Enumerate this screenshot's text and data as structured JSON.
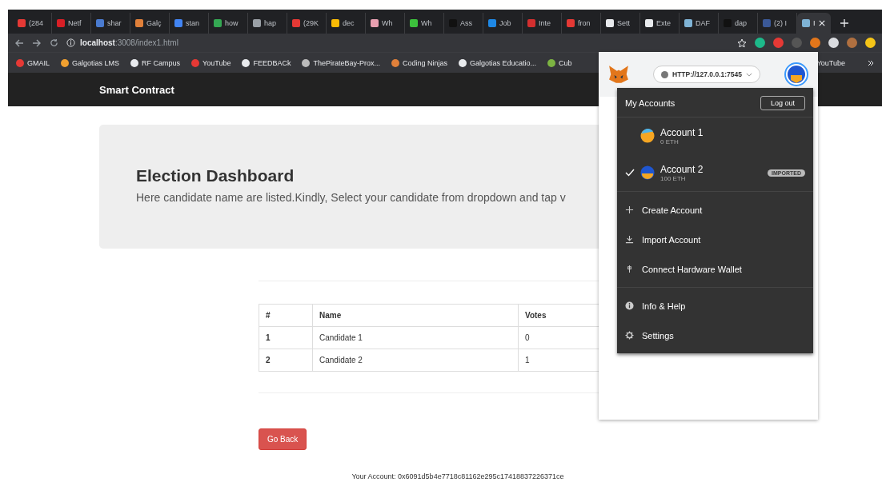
{
  "browser": {
    "tabs": [
      {
        "label": "(284",
        "color": "#e53935",
        "selected": false
      },
      {
        "label": "Netf",
        "color": "#d81f26",
        "selected": false
      },
      {
        "label": "shar",
        "color": "#4a7bd0",
        "selected": false
      },
      {
        "label": "Galç",
        "color": "#e0803a",
        "selected": false
      },
      {
        "label": "stan",
        "color": "#4285f4",
        "selected": false
      },
      {
        "label": "how",
        "color": "#34a853",
        "selected": false
      },
      {
        "label": "hap",
        "color": "#9aa0a6",
        "selected": false
      },
      {
        "label": "(29K",
        "color": "#e53935",
        "selected": false
      },
      {
        "label": "dec",
        "color": "#fbbc05",
        "selected": false
      },
      {
        "label": "Wh",
        "color": "#e8a0b0",
        "selected": false
      },
      {
        "label": "Wh",
        "color": "#3cc13c",
        "selected": false
      },
      {
        "label": "Ass",
        "color": "#111111",
        "selected": false
      },
      {
        "label": "Job",
        "color": "#1e88e5",
        "selected": false
      },
      {
        "label": "Inte",
        "color": "#d32f2f",
        "selected": false
      },
      {
        "label": "fron",
        "color": "#e53935",
        "selected": false
      },
      {
        "label": "Sett",
        "color": "#e8eaed",
        "selected": false
      },
      {
        "label": "Exte",
        "color": "#e8eaed",
        "selected": false
      },
      {
        "label": "DAF",
        "color": "#7fb3d5",
        "selected": false
      },
      {
        "label": "dap",
        "color": "#111111",
        "selected": false
      },
      {
        "label": "(2) I",
        "color": "#3b5998",
        "selected": false
      },
      {
        "label": "I",
        "color": "#7fb3d5",
        "selected": true
      }
    ],
    "address": {
      "host": "localhost",
      "path": ":3008/index1.html"
    },
    "bookmarks": [
      {
        "label": "GMAIL",
        "color": "#e53935"
      },
      {
        "label": "Galgotias LMS",
        "color": "#f0a030"
      },
      {
        "label": "RF Campus",
        "color": "#e8eaed"
      },
      {
        "label": "YouTube",
        "color": "#e53935"
      },
      {
        "label": "FEEDBACk",
        "color": "#e8eaed"
      },
      {
        "label": "ThePirateBay-Prox...",
        "color": "#bbbbbb"
      },
      {
        "label": "Coding Ninjas",
        "color": "#e0803a"
      },
      {
        "label": "Galgotias Educatio...",
        "color": "#e8eaed"
      },
      {
        "label": "Cub",
        "color": "#7cb342"
      }
    ],
    "bookmarks_right": [
      {
        "label": "YouTube"
      }
    ]
  },
  "page": {
    "brand": "Smart Contract",
    "title": "Election Dashboard",
    "subtitle": "Here candidate name are listed.Kindly, Select your candidate from dropdown and tap v",
    "table": {
      "columns": [
        "#",
        "Name",
        "Votes"
      ],
      "rows": [
        [
          "1",
          "Candidate 1",
          "0"
        ],
        [
          "2",
          "Candidate 2",
          "1"
        ]
      ]
    },
    "back_button": "Go Back",
    "account": "Your Account: 0x6091d5b4e7718c81162e295c17418837226371ce"
  },
  "wallet": {
    "network": "HTTP://127.0.0.1:7545",
    "menu_title": "My Accounts",
    "logout": "Log out",
    "accounts": [
      {
        "name": "Account 1",
        "balance": "0 ETH",
        "selected": false
      },
      {
        "name": "Account 2",
        "balance": "100 ETH",
        "selected": true,
        "badge": "IMPORTED"
      }
    ],
    "actions": [
      {
        "kind": "create",
        "label": "Create Account"
      },
      {
        "kind": "import",
        "label": "Import Account"
      },
      {
        "kind": "hardware",
        "label": "Connect Hardware Wallet"
      }
    ],
    "links": [
      {
        "kind": "info",
        "label": "Info & Help"
      },
      {
        "kind": "settings",
        "label": "Settings"
      }
    ]
  }
}
